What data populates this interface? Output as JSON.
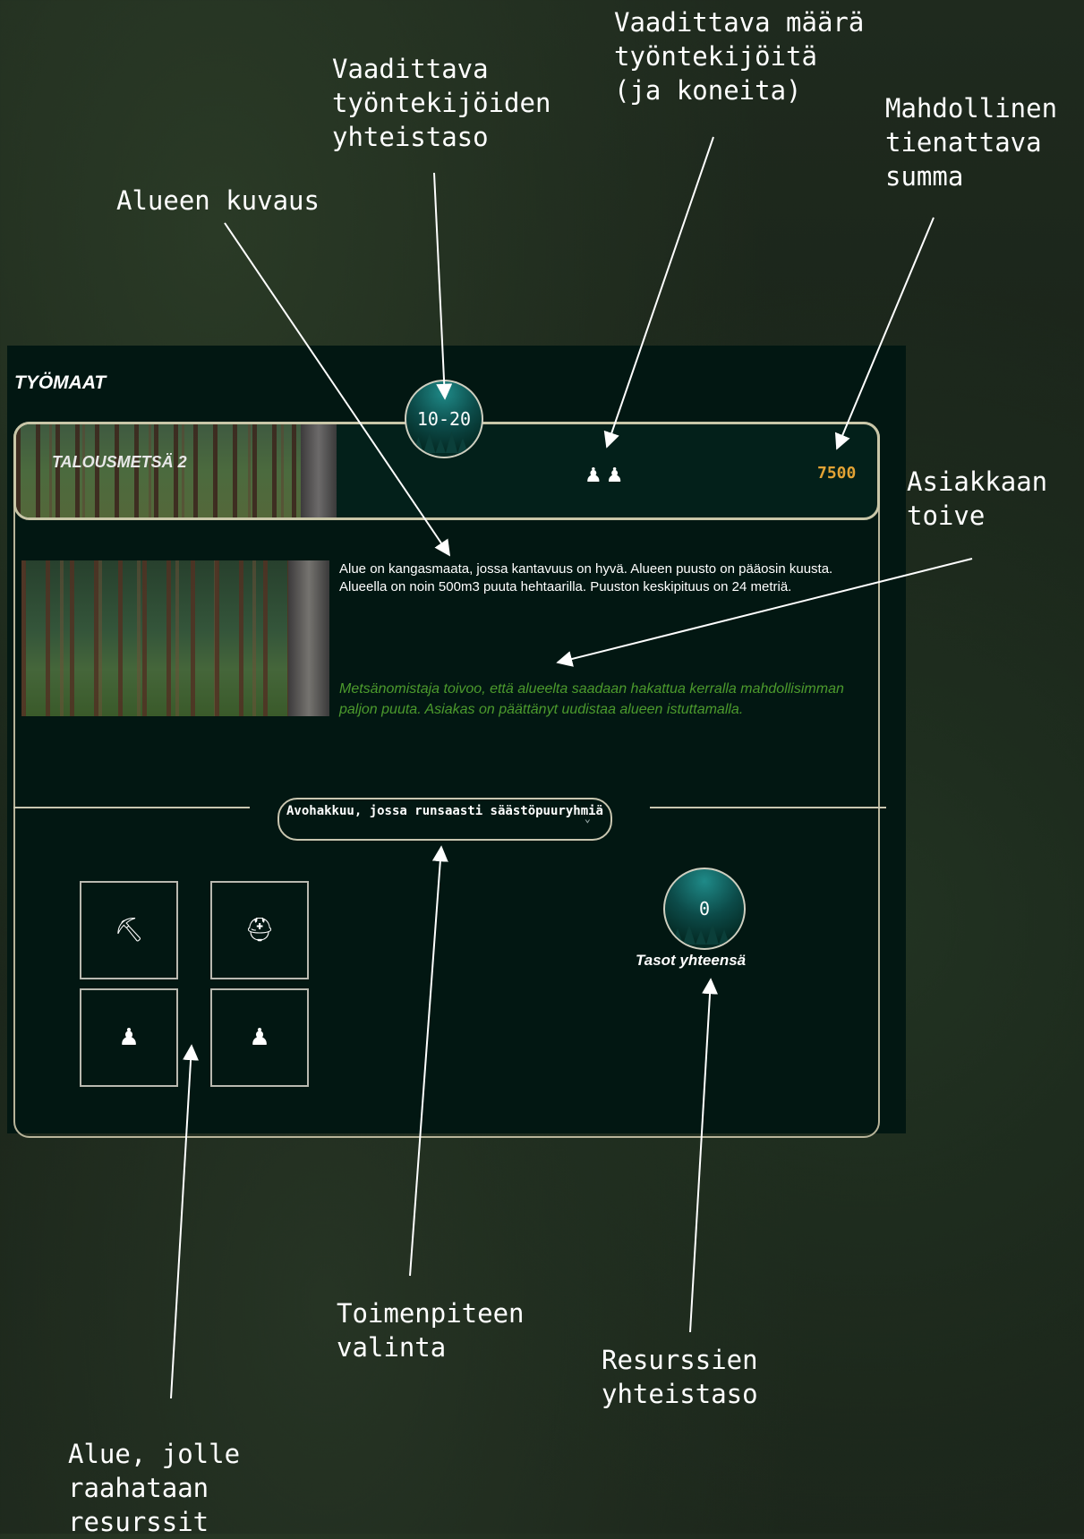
{
  "annotations": {
    "required_level": "Vaadittava\ntyöntekijöiden\nyhteistaso",
    "required_workers": "Vaadittava määrä\ntyöntekijöitä\n(ja koneita)",
    "possible_earnings": "Mahdollinen\ntienattava\nsumma",
    "area_description": "Alueen kuvaus",
    "customer_wish": "Asiakkaan\ntoive",
    "action_selection": "Toimenpiteen\nvalinta",
    "resource_level": "Resurssien\nyhteistaso",
    "resource_drop_area": "Alue, jolle\nraahataan\nresurssit"
  },
  "panel": {
    "title": "TYÖMAAT",
    "site": {
      "name": "TALOUSMETSÄ 2",
      "level_range": "10-20",
      "workers_icons": "♟♟",
      "reward": "7500",
      "description": " Alue on kangasmaata, jossa kantavuus on hyvä. Alueen puusto on pääosin kuusta. Alueella on noin 500m3 puuta hehtaarilla. Puuston keskipituus on 24 metriä.",
      "customer_wish": "Metsänomistaja toivoo, että alueelta saadaan hakattua kerralla mahdollisimman paljon puuta. Asiakas on päättänyt uudistaa alueen istuttamalla.",
      "action": "Avohakkuu, jossa runsaasti säästöpuuryhmiä",
      "total_levels_value": "0",
      "total_levels_label": "Tasot yhteensä"
    },
    "resource_slots": [
      {
        "icon": "axe-icon",
        "glyph": "⛏"
      },
      {
        "icon": "helmet-icon",
        "glyph": "⛑"
      },
      {
        "icon": "worker-icon",
        "glyph": "♟"
      },
      {
        "icon": "worker-icon",
        "glyph": "♟"
      }
    ]
  }
}
